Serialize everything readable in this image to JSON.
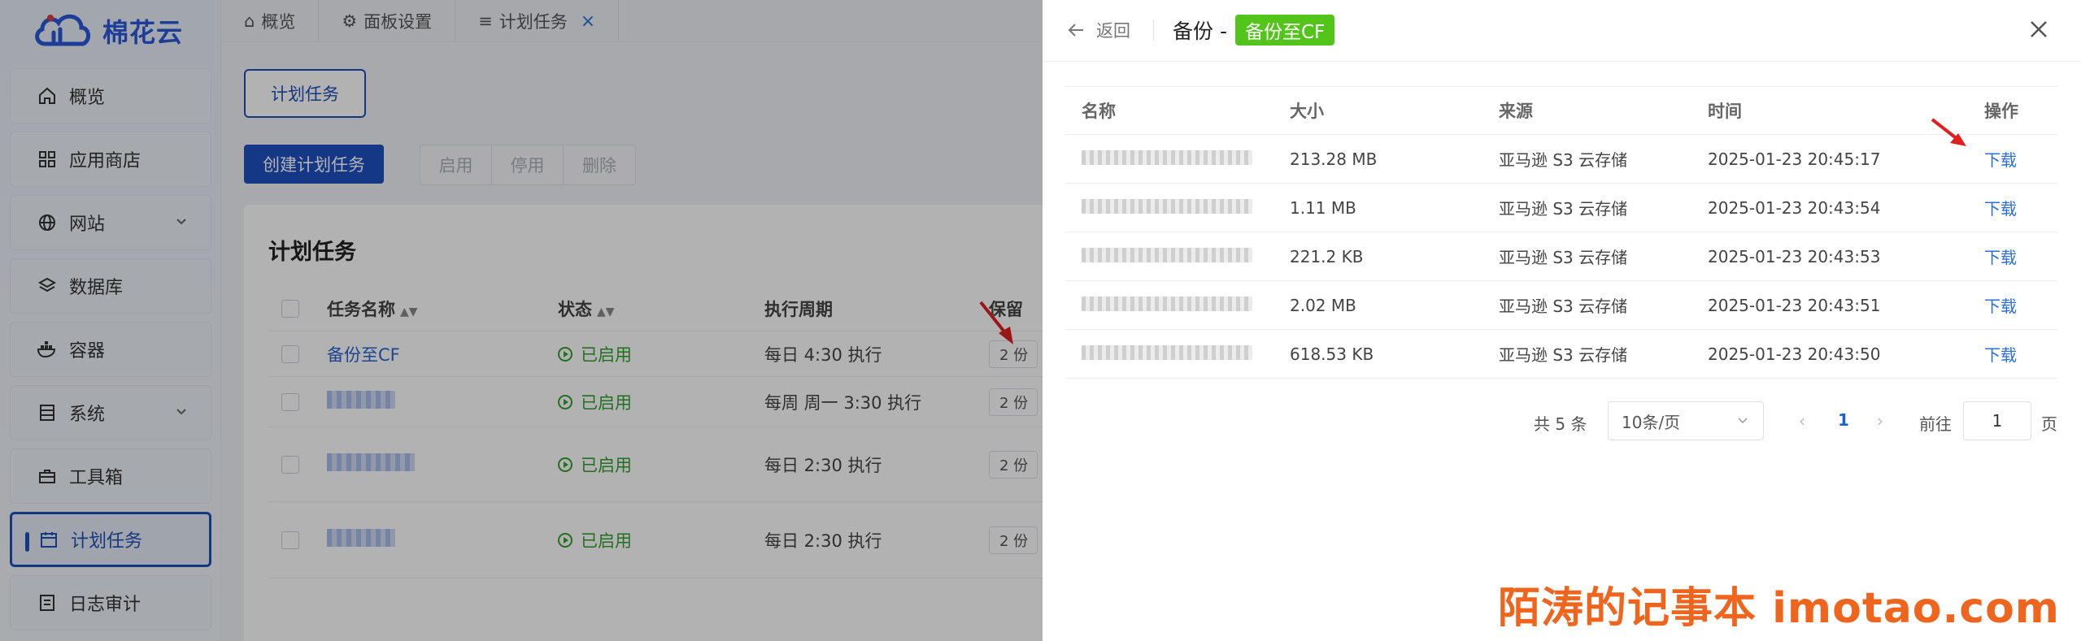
{
  "brand": {
    "name": "棉花云"
  },
  "sidebar": {
    "items": [
      {
        "label": "概览",
        "icon": "home-icon"
      },
      {
        "label": "应用商店",
        "icon": "grid-icon"
      },
      {
        "label": "网站",
        "icon": "globe-icon",
        "expandable": true
      },
      {
        "label": "数据库",
        "icon": "layers-icon"
      },
      {
        "label": "容器",
        "icon": "docker-icon"
      },
      {
        "label": "系统",
        "icon": "server-icon",
        "expandable": true
      },
      {
        "label": "工具箱",
        "icon": "toolbox-icon"
      },
      {
        "label": "计划任务",
        "icon": "calendar-icon",
        "active": true
      },
      {
        "label": "日志审计",
        "icon": "log-icon"
      }
    ]
  },
  "tabs": [
    {
      "label": "概览",
      "icon": "home-icon"
    },
    {
      "label": "面板设置",
      "icon": "gear-icon"
    },
    {
      "label": "计划任务",
      "icon": "list-icon",
      "closable": true,
      "close": "×"
    }
  ],
  "main": {
    "tab_button": "计划任务",
    "create_button": "创建计划任务",
    "actions": [
      "启用",
      "停用",
      "删除"
    ],
    "panel_title": "计划任务",
    "columns": [
      "任务名称",
      "状态",
      "执行周期",
      "保留"
    ],
    "rows": [
      {
        "name": "备份至CF",
        "status": "已启用",
        "cycle": "每日 4:30 执行",
        "keep": "2 份"
      },
      {
        "name": "",
        "status": "已启用",
        "cycle": "每周 周一 3:30 执行",
        "keep": "2 份"
      },
      {
        "name": "",
        "status": "已启用",
        "cycle": "每日 2:30 执行",
        "keep": "2 份"
      },
      {
        "name": "",
        "status": "已启用",
        "cycle": "每日 2:30 执行",
        "keep": "2 份"
      }
    ]
  },
  "drawer": {
    "back_label": "返回",
    "title": "备份 -",
    "tag": "备份至CF",
    "columns": {
      "name": "名称",
      "size": "大小",
      "source": "来源",
      "time": "时间",
      "op": "操作"
    },
    "rows": [
      {
        "size": "213.28 MB",
        "source": "亚马逊 S3 云存储",
        "time": "2025-01-23 20:45:17",
        "op": "下载"
      },
      {
        "size": "1.11 MB",
        "source": "亚马逊 S3 云存储",
        "time": "2025-01-23 20:43:54",
        "op": "下载"
      },
      {
        "size": "221.2 KB",
        "source": "亚马逊 S3 云存储",
        "time": "2025-01-23 20:43:53",
        "op": "下载"
      },
      {
        "size": "2.02 MB",
        "source": "亚马逊 S3 云存储",
        "time": "2025-01-23 20:43:51",
        "op": "下载"
      },
      {
        "size": "618.53 KB",
        "source": "亚马逊 S3 云存储",
        "time": "2025-01-23 20:43:50",
        "op": "下载"
      }
    ],
    "pagination": {
      "total": "共 5 条",
      "page_size": "10条/页",
      "current_page": "1",
      "goto_label": "前往",
      "goto_value": "1",
      "page_suffix": "页"
    }
  },
  "watermark": "陌涛的记事本 imotao.com",
  "colors": {
    "primary": "#1e50c0",
    "success": "#52c41a",
    "link": "#2c6fd6",
    "watermark": "#f0651e",
    "annotation_arrow": "#e02020"
  }
}
